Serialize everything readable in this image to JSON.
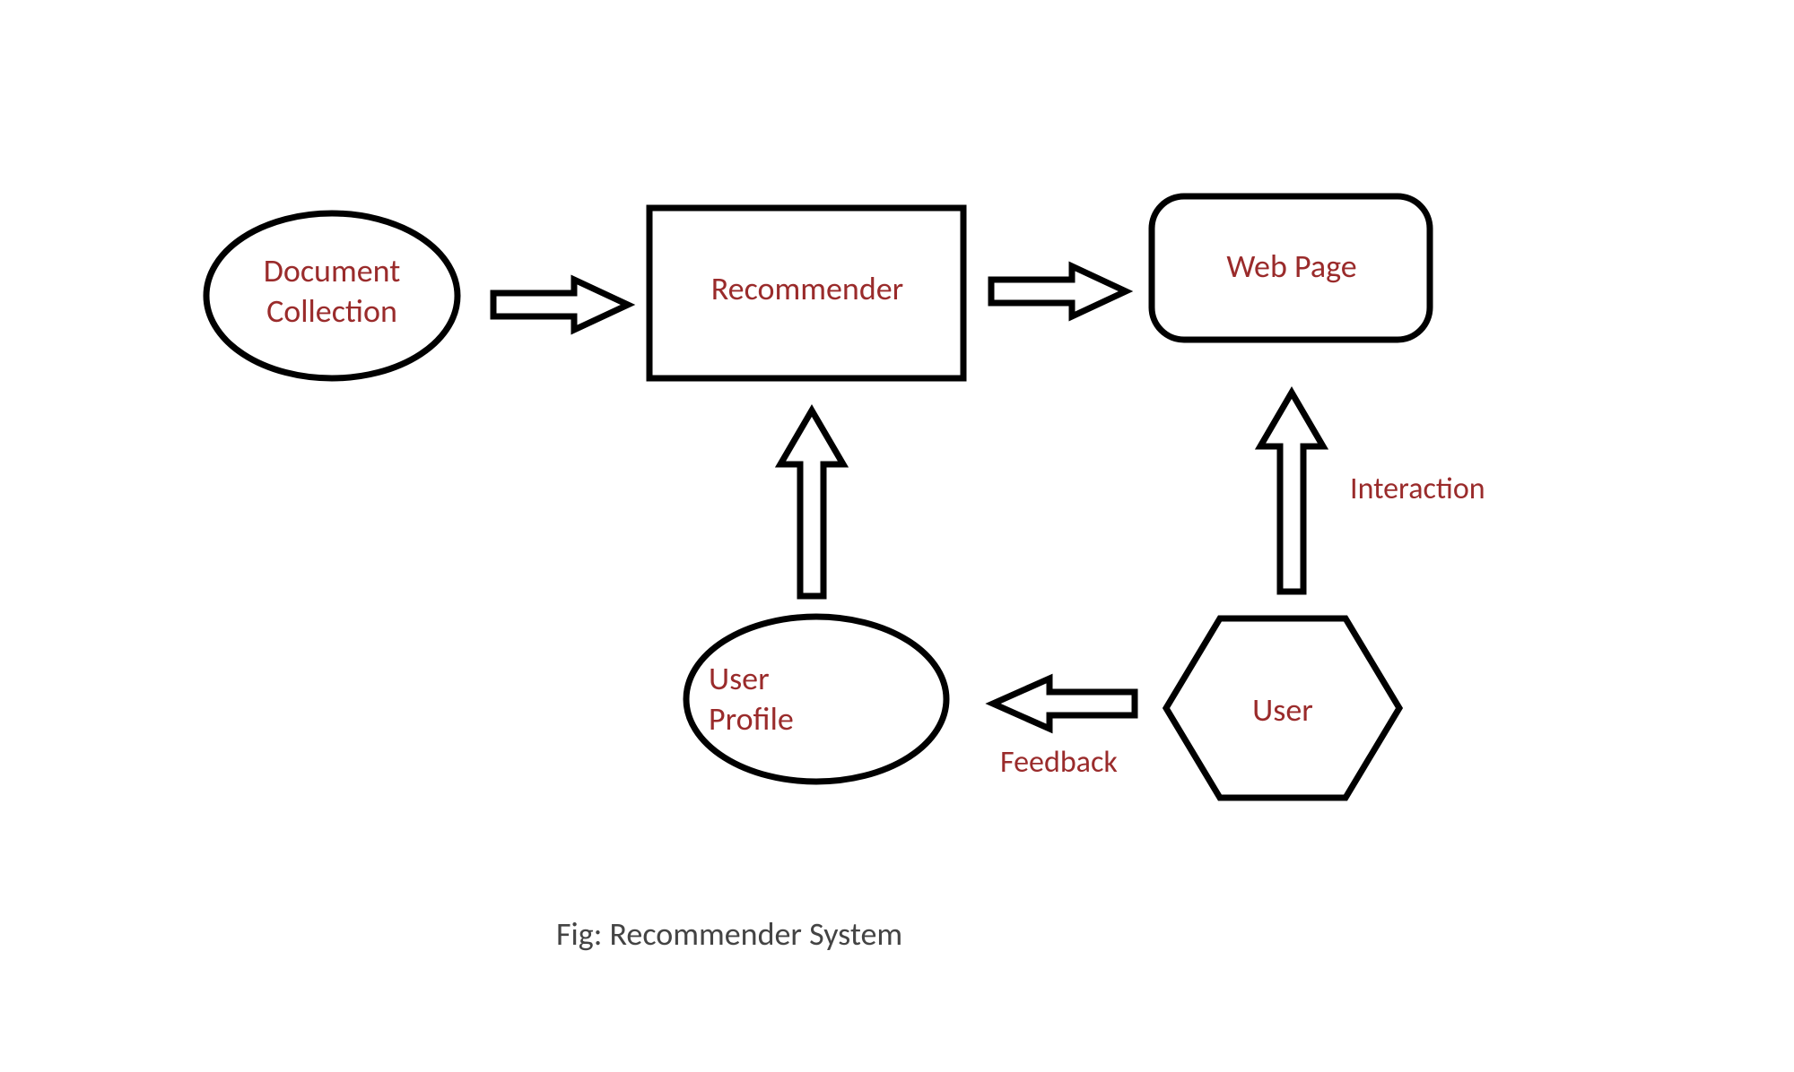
{
  "diagram": {
    "caption": "Fig: Recommender System",
    "nodes": {
      "document_collection": {
        "label": "Document\nCollection",
        "shape": "ellipse"
      },
      "recommender": {
        "label": "Recommender",
        "shape": "rect"
      },
      "web_page": {
        "label": "Web Page",
        "shape": "rounded-rect"
      },
      "user_profile": {
        "label": "User\nProfile",
        "shape": "ellipse"
      },
      "user": {
        "label": "User",
        "shape": "hexagon"
      }
    },
    "edges": {
      "doc_to_recommender": {
        "from": "document_collection",
        "to": "recommender",
        "direction": "right",
        "label": ""
      },
      "recommender_to_webpage": {
        "from": "recommender",
        "to": "web_page",
        "direction": "right",
        "label": ""
      },
      "userprofile_to_recommender": {
        "from": "user_profile",
        "to": "recommender",
        "direction": "up",
        "label": ""
      },
      "user_to_webpage": {
        "from": "user",
        "to": "web_page",
        "direction": "up",
        "label": "Interaction"
      },
      "user_to_userprofile": {
        "from": "user",
        "to": "user_profile",
        "direction": "left",
        "label": "Feedback"
      }
    },
    "colors": {
      "stroke": "#000000",
      "label": "#9a2b2b",
      "caption": "#444444",
      "background": "#ffffff"
    }
  }
}
